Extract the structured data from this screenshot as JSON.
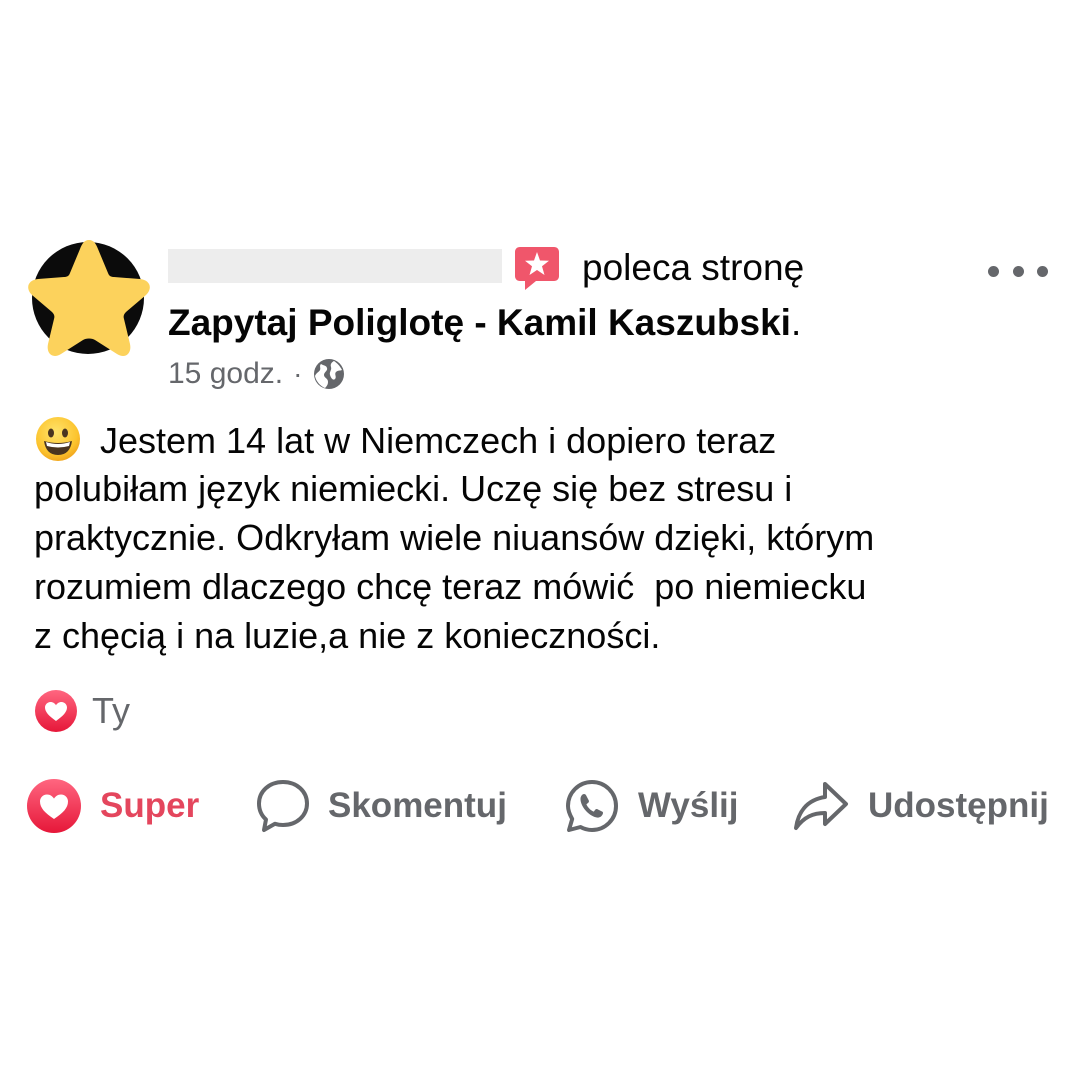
{
  "post": {
    "recommend_text": "poleca stronę",
    "page_name": "Zapytaj Poliglotę - Kamil Kaszubski",
    "page_name_suffix": ".",
    "time": "15 godz.",
    "meta_separator": "·",
    "body_lines": [
      "Jestem 14 lat w Niemczech i dopiero teraz",
      "polubiłam język niemiecki. Uczę się bez stresu i",
      "praktycznie. Odkryłam wiele niuansów dzięki, którym",
      "rozumiem dlaczego chcę teraz mówić  po niemiecku",
      "z chęcią i na luzie,a nie z konieczności."
    ]
  },
  "reactions": {
    "text": "Ty",
    "icon": "heart-reaction-icon"
  },
  "actions": {
    "super": "Super",
    "comment": "Skomentuj",
    "send": "Wyślij",
    "share": "Udostępnij"
  },
  "icons": {
    "avatar": "star-avatar",
    "recommend": "recommend-star-bubble-icon",
    "audience": "globe-icon",
    "more": "more-options-icon",
    "emoji": "grinning-face-emoji"
  },
  "colors": {
    "accent_red": "#e4465d",
    "secondary_text": "#65676b",
    "primary_text": "#050505",
    "avatar_star": "#fcd25c"
  }
}
